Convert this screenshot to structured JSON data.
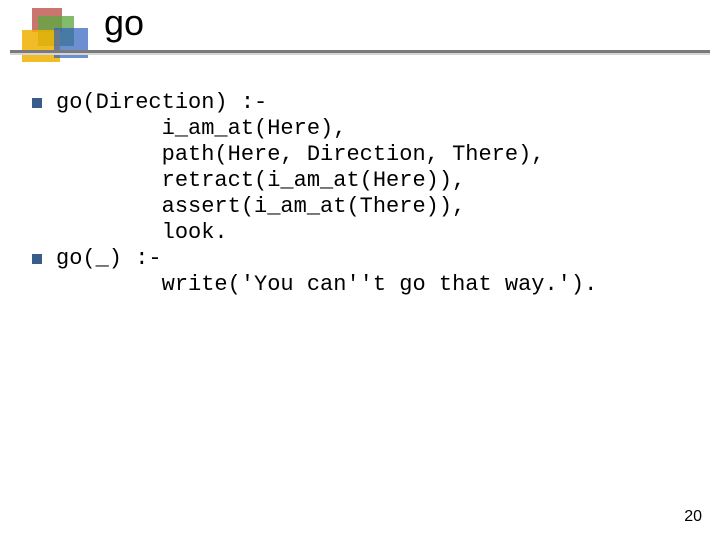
{
  "title": "go",
  "code_block_1": "go(Direction) :-\n        i_am_at(Here),\n        path(Here, Direction, There),\n        retract(i_am_at(Here)),\n        assert(i_am_at(There)),\n        look.",
  "code_block_2": "go(_) :-\n        write('You can''t go that way.').",
  "page_number": "20"
}
